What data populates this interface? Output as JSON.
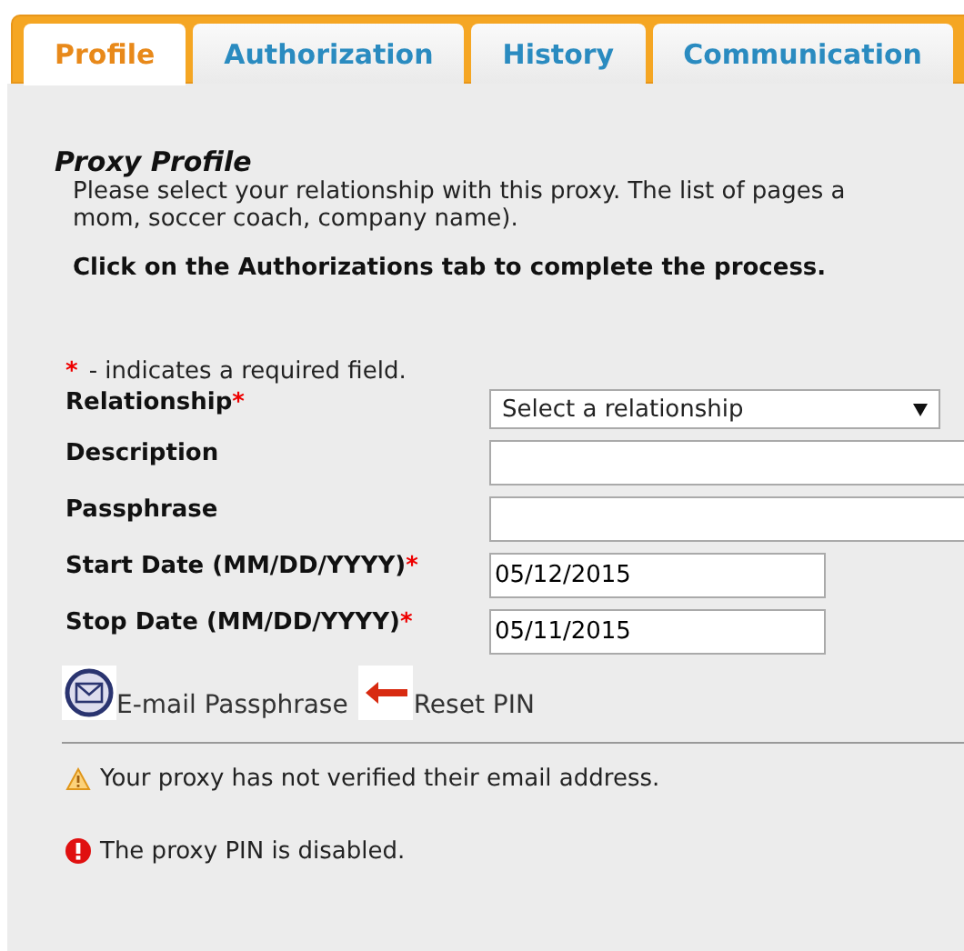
{
  "tabs": [
    {
      "label": "Profile",
      "selected": true
    },
    {
      "label": "Authorization",
      "selected": false
    },
    {
      "label": "History",
      "selected": false
    },
    {
      "label": "Communication",
      "selected": false
    }
  ],
  "section_title": "Proxy Profile",
  "intro_lines": [
    "Please select your relationship with this proxy. The list of pages a",
    "mom, soccer coach, company name)."
  ],
  "instruction": "Click on the Authorizations tab to complete the process.",
  "required_note": {
    "mark": "*",
    "text": "- indicates a required field."
  },
  "fields": [
    {
      "label": "Relationship",
      "required": true,
      "kind": "select",
      "value": "Select a relationship"
    },
    {
      "label": "Description",
      "required": false,
      "kind": "text"
    },
    {
      "label": "Passphrase",
      "required": false,
      "kind": "text"
    },
    {
      "label": "Start Date (MM/DD/YYYY)",
      "required": true,
      "kind": "date",
      "value": "05/12/2015"
    },
    {
      "label": "Stop Date (MM/DD/YYYY)",
      "required": true,
      "kind": "date",
      "value": "05/11/2015"
    }
  ],
  "required_mark": "*",
  "actions": [
    {
      "label": "E-mail Passphrase",
      "kind": "email"
    },
    {
      "label": "Reset PIN",
      "kind": "reset"
    }
  ],
  "messages": [
    {
      "kind": "warning",
      "text": "Your proxy has not verified their email address."
    },
    {
      "kind": "error",
      "text": "The proxy PIN is disabled."
    }
  ]
}
